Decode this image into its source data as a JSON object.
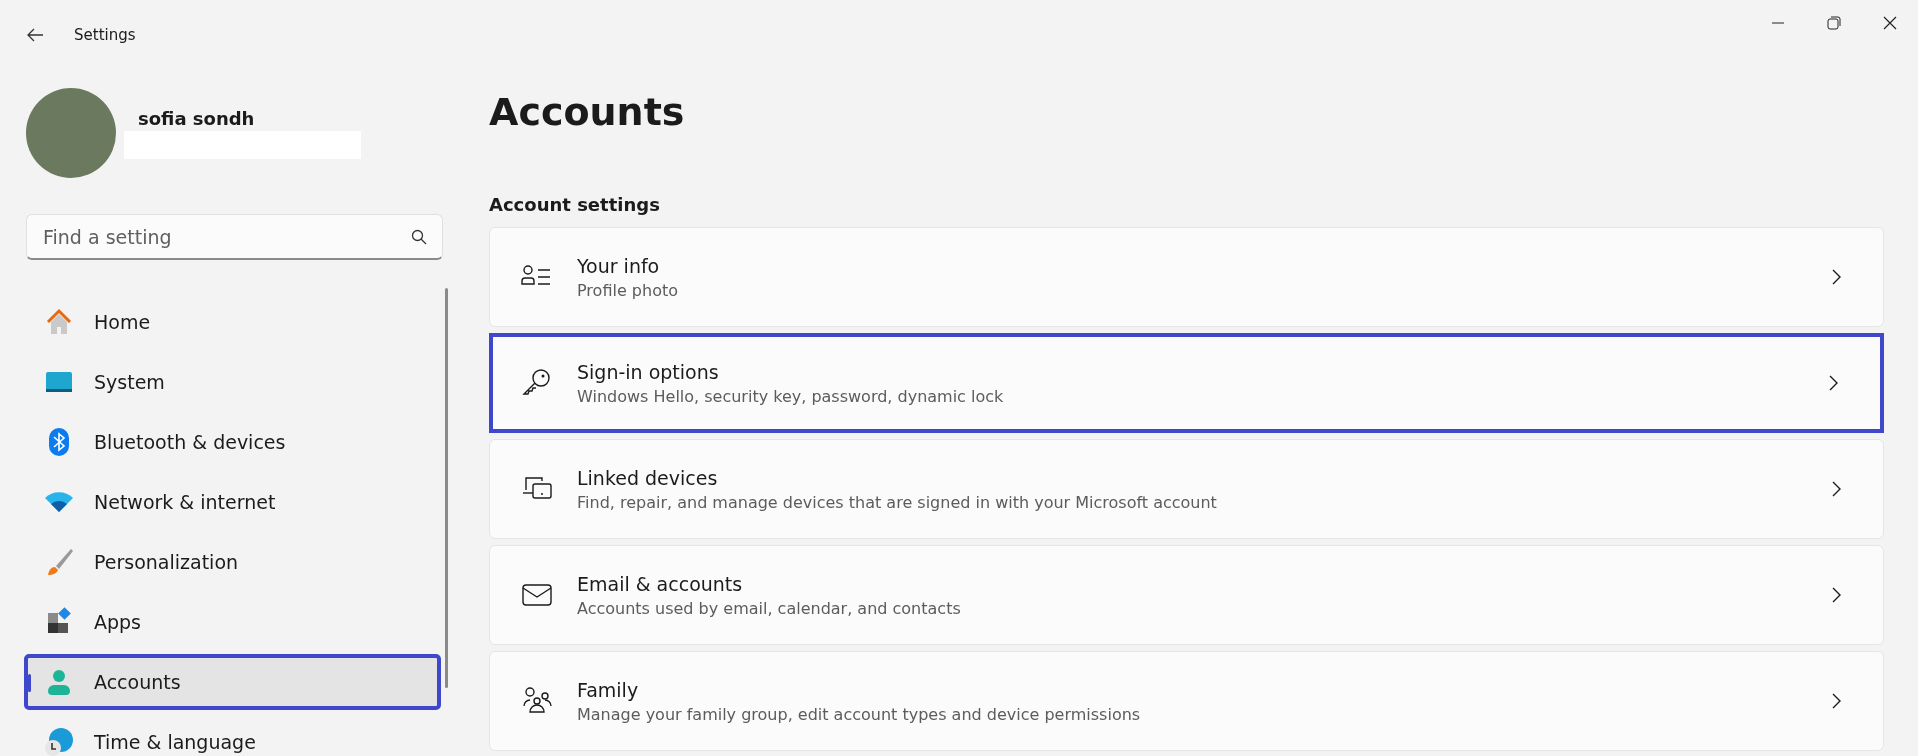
{
  "window": {
    "title": "Settings"
  },
  "user": {
    "name": "sofia sondh"
  },
  "search": {
    "placeholder": "Find a setting"
  },
  "sidebar": {
    "items": [
      {
        "label": "Home",
        "selected": false,
        "highlighted": false
      },
      {
        "label": "System",
        "selected": false,
        "highlighted": false
      },
      {
        "label": "Bluetooth & devices",
        "selected": false,
        "highlighted": false
      },
      {
        "label": "Network & internet",
        "selected": false,
        "highlighted": false
      },
      {
        "label": "Personalization",
        "selected": false,
        "highlighted": false
      },
      {
        "label": "Apps",
        "selected": false,
        "highlighted": false
      },
      {
        "label": "Accounts",
        "selected": true,
        "highlighted": true
      },
      {
        "label": "Time & language",
        "selected": false,
        "highlighted": false
      }
    ]
  },
  "page": {
    "title": "Accounts",
    "section": "Account settings",
    "cards": [
      {
        "title": "Your info",
        "subtitle": "Profile photo",
        "highlighted": false
      },
      {
        "title": "Sign-in options",
        "subtitle": "Windows Hello, security key, password, dynamic lock",
        "highlighted": true
      },
      {
        "title": "Linked devices",
        "subtitle": "Find, repair, and manage devices that are signed in with your Microsoft account",
        "highlighted": false
      },
      {
        "title": "Email & accounts",
        "subtitle": "Accounts used by email, calendar, and contacts",
        "highlighted": false
      },
      {
        "title": "Family",
        "subtitle": "Manage your family group, edit account types and device permissions",
        "highlighted": false
      }
    ]
  }
}
